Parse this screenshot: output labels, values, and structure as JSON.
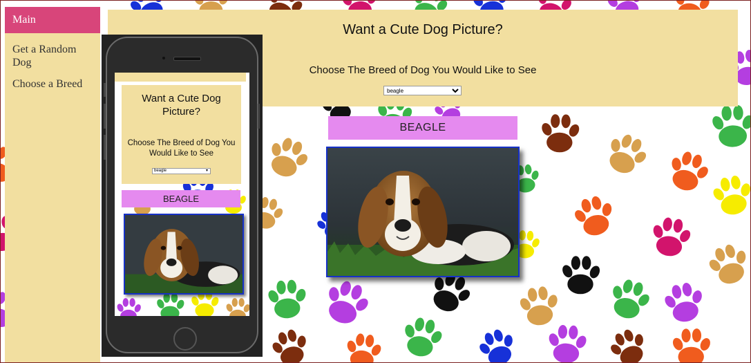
{
  "sidebar": {
    "items": [
      {
        "label": "Main",
        "active": true
      },
      {
        "label": "Get a Random Dog",
        "active": false
      },
      {
        "label": "Choose a Breed",
        "active": false
      }
    ]
  },
  "header": {
    "title": "Want a Cute Dog Picture?",
    "subtitle": "Choose The Breed of Dog You Would Like to See",
    "selected_breed": "beagle"
  },
  "result": {
    "breed_label": "BEAGLE"
  },
  "mobile_preview": {
    "title": "Want a Cute Dog Picture?",
    "subtitle": "Choose The Breed of Dog You Would Like to See",
    "selected_breed": "beagle",
    "breed_label": "BEAGLE"
  },
  "colors": {
    "panel": "#f2dfa0",
    "sidebar_active": "#d8457a",
    "breed_label_bg": "#e58aef",
    "photo_border": "#1631c8",
    "paw_palette": [
      "#7c2d0e",
      "#d7a04e",
      "#f6ec00",
      "#d2146c",
      "#f05c1e",
      "#3bb54a",
      "#b43ee0",
      "#1731d8",
      "#111111"
    ]
  },
  "icons": [
    "paw-print-icon",
    "dropdown-arrow-icon"
  ]
}
